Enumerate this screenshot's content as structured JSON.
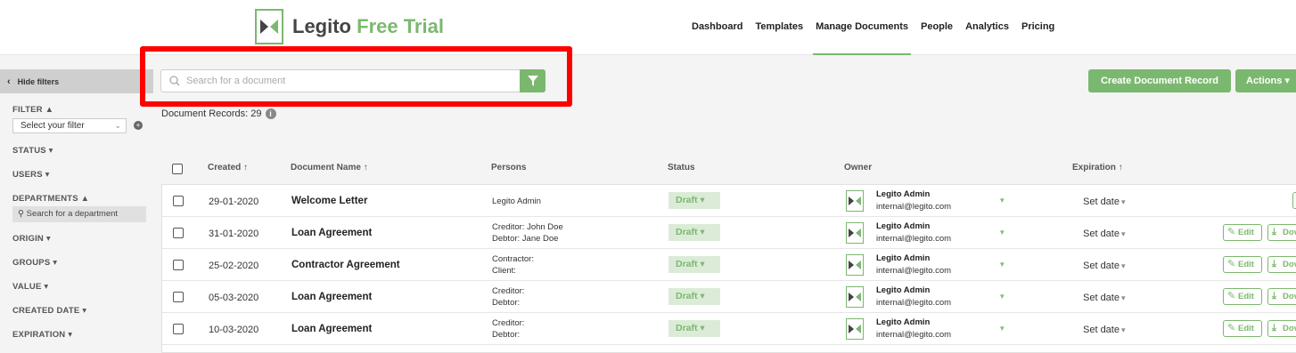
{
  "header": {
    "logo_name": "Legito",
    "logo_accent": "Free Trial",
    "nav": [
      {
        "label": "Dashboard"
      },
      {
        "label": "Templates"
      },
      {
        "label": "Manage Documents"
      },
      {
        "label": "People"
      },
      {
        "label": "Analytics"
      },
      {
        "label": "Pricing"
      }
    ],
    "active_nav": "Manage Documents"
  },
  "sidebar": {
    "hide_filters": "Hide filters",
    "filter_label": "FILTER ▲",
    "filter_select": "Select your filter",
    "sections": [
      {
        "label": "STATUS ▾"
      },
      {
        "label": "USERS ▾"
      },
      {
        "label": "DEPARTMENTS ▲"
      },
      {
        "label": "ORIGIN ▾"
      },
      {
        "label": "GROUPS ▾"
      },
      {
        "label": "VALUE ▾"
      },
      {
        "label": "CREATED DATE ▾"
      },
      {
        "label": "EXPIRATION ▾"
      }
    ],
    "department_search": "Search for a department"
  },
  "search": {
    "placeholder": "Search for a document",
    "value": ""
  },
  "records": {
    "label": "Document Records: 29",
    "info": "i"
  },
  "toolbar": {
    "create_label": "Create Document Record",
    "actions_label": "Actions ▾"
  },
  "table": {
    "headers": {
      "created": "Created ↑",
      "name": "Document Name ↑",
      "persons": "Persons",
      "status": "Status",
      "owner": "Owner",
      "expiration": "Expiration ↑"
    },
    "rows": [
      {
        "created": "29-01-2020",
        "name": "Welcome Letter",
        "persons": [
          "Legito Admin"
        ],
        "status": "Draft ▾",
        "owner_name": "Legito Admin",
        "owner_email": "internal@legito.com",
        "expiration": "Set date"
      },
      {
        "created": "31-01-2020",
        "name": "Loan Agreement",
        "persons": [
          "Creditor: John Doe",
          "Debtor: Jane Doe"
        ],
        "status": "Draft ▾",
        "owner_name": "Legito Admin",
        "owner_email": "internal@legito.com",
        "expiration": "Set date"
      },
      {
        "created": "25-02-2020",
        "name": "Contractor Agreement",
        "persons": [
          "Contractor:",
          "Client:"
        ],
        "status": "Draft ▾",
        "owner_name": "Legito Admin",
        "owner_email": "internal@legito.com",
        "expiration": "Set date"
      },
      {
        "created": "05-03-2020",
        "name": "Loan Agreement",
        "persons": [
          "Creditor:",
          "Debtor:"
        ],
        "status": "Draft ▾",
        "owner_name": "Legito Admin",
        "owner_email": "internal@legito.com",
        "expiration": "Set date"
      },
      {
        "created": "10-03-2020",
        "name": "Loan Agreement",
        "persons": [
          "Creditor:",
          "Debtor:"
        ],
        "status": "Draft ▾",
        "owner_name": "Legito Admin",
        "owner_email": "internal@legito.com",
        "expiration": "Set date"
      }
    ],
    "edit_label": "Edit",
    "download_label": "Dov"
  },
  "colors": {
    "accent": "#7bb86f",
    "highlight": "#ff0000"
  }
}
